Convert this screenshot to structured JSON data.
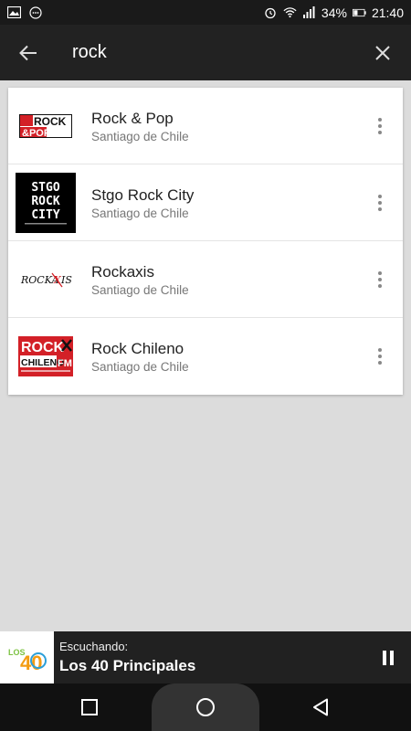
{
  "status_bar": {
    "battery": "34%",
    "time": "21:40"
  },
  "search": {
    "query": "rock"
  },
  "results": [
    {
      "title": "Rock & Pop",
      "subtitle": "Santiago de Chile",
      "logo": "rock-pop-logo",
      "logo_text": [
        "ROCK",
        "&POP"
      ]
    },
    {
      "title": "Stgo Rock City",
      "subtitle": "Santiago de Chile",
      "logo": "stgo-rock-city-logo",
      "logo_text": [
        "STGO",
        "ROCK",
        "CITY"
      ]
    },
    {
      "title": "Rockaxis",
      "subtitle": "Santiago de Chile",
      "logo": "rockaxis-logo",
      "logo_text": [
        "ROCKAXIS"
      ]
    },
    {
      "title": "Rock Chileno",
      "subtitle": "Santiago de Chile",
      "logo": "rock-chileno-logo",
      "logo_text": [
        "ROCK",
        "CHILENO",
        "FM"
      ]
    }
  ],
  "now_playing": {
    "label": "Escuchando:",
    "title": "Los 40 Principales",
    "logo": "los40-logo",
    "logo_text": "LOS40"
  },
  "icons": {
    "back": "arrow-left-icon",
    "clear": "close-icon",
    "more": "more-vert-icon",
    "pause": "pause-icon",
    "nav_recents": "square-icon",
    "nav_home": "circle-icon",
    "nav_back": "triangle-icon"
  },
  "colors": {
    "app_bar": "#222222",
    "background": "#dcdcdc",
    "accent_red": "#d32027"
  }
}
